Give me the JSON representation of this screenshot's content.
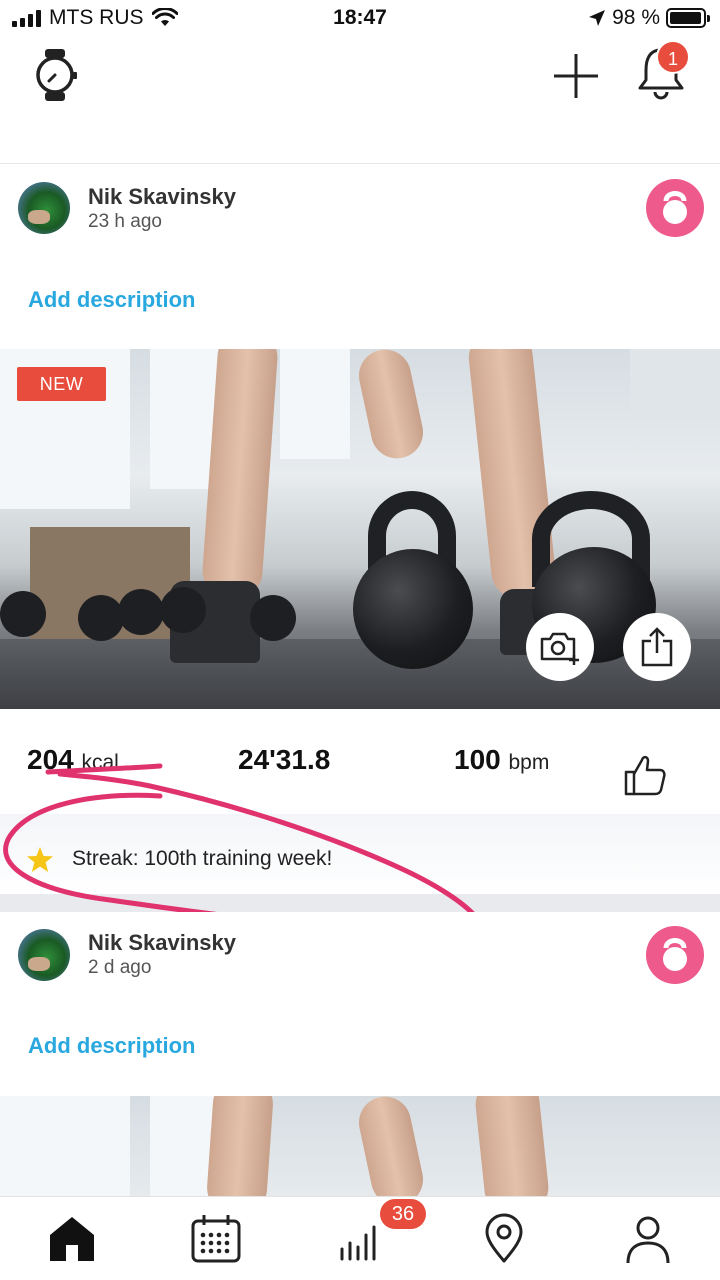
{
  "status_bar": {
    "carrier": "MTS RUS",
    "time": "18:47",
    "battery": "98 %",
    "battery_level": 0.98,
    "signal_bars": 4
  },
  "header": {
    "notification_count": "1",
    "icons": [
      "watch-icon",
      "plus-icon",
      "bell-icon"
    ]
  },
  "colors": {
    "accent_blue": "#29a8e0",
    "badge_red": "#e74c3c",
    "activity_pink": "#ee5a8c",
    "annotation_pink": "#e0336e",
    "star_yellow": "#f5c518"
  },
  "feed": [
    {
      "author": "Nik Skavinsky",
      "time_ago": "23 h ago",
      "add_description": "Add description",
      "badge": "NEW",
      "activity_icon": "kettlebell-icon",
      "stats": {
        "calories_value": "204",
        "calories_unit": "kcal",
        "duration": "24'31.8",
        "heart_rate_value": "100",
        "heart_rate_unit": "bpm"
      },
      "streak": "Streak: 100th training week!"
    },
    {
      "author": "Nik Skavinsky",
      "time_ago": "2 d ago",
      "add_description": "Add description",
      "activity_icon": "kettlebell-icon"
    }
  ],
  "bottom_nav": {
    "items": [
      "home-icon",
      "calendar-icon",
      "stats-icon",
      "map-pin-icon",
      "profile-icon"
    ],
    "stats_badge": "36"
  }
}
